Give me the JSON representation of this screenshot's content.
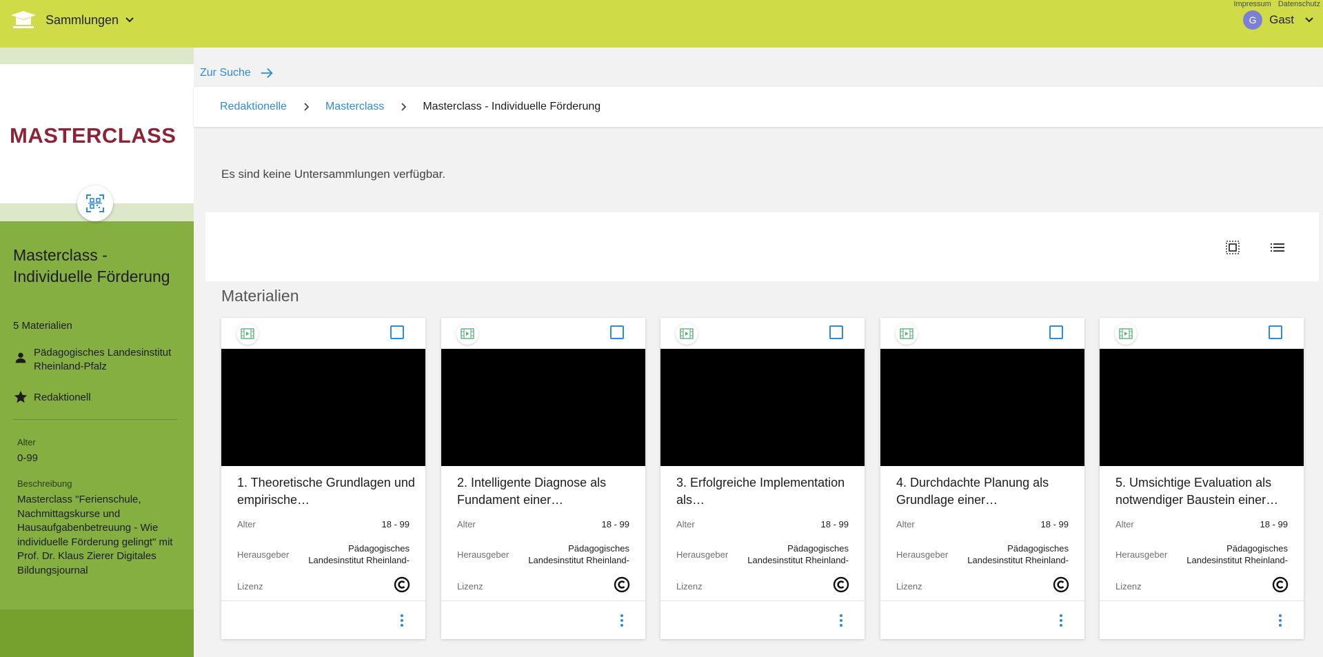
{
  "header": {
    "app_label": "Sammlungen",
    "impressum": "Impressum",
    "datenschutz": "Datenschutz",
    "user_initial": "G",
    "user_name": "Gast"
  },
  "sidebar": {
    "logo_text": "MASTERCLASS",
    "title": "Masterclass - Individuelle Förderung",
    "count": "5 Materialien",
    "publisher": "Pädagogisches Landesinstitut Rheinland-Pfalz",
    "editorial": "Redaktionell",
    "age_label": "Alter",
    "age_value": "0-99",
    "description_label": "Beschreibung",
    "description": "Masterclass \"Ferienschule, Nachmittagskurse und Hausaufgabenbetreuung - Wie individuelle Förderung gelingt\" mit Prof. Dr. Klaus Zierer Digitales Bildungsjournal"
  },
  "main": {
    "to_search": "Zur Suche",
    "breadcrumb": [
      "Redaktionelle",
      "Masterclass",
      "Masterclass - Individuelle Förderung"
    ],
    "no_subcollections": "Es sind keine Untersammlungen verfügbar.",
    "materials_heading": "Materialien"
  },
  "cards": [
    {
      "title": "1. Theoretische Grundlagen und empirische…",
      "age_label": "Alter",
      "age_value": "18 - 99",
      "publisher_label": "Herausgeber",
      "publisher_line1": "Pädagogisches",
      "publisher_line2": "Landesinstitut Rheinland-",
      "license_label": "Lizenz"
    },
    {
      "title": "2. Intelligente Diagnose als Fundament einer…",
      "age_label": "Alter",
      "age_value": "18 - 99",
      "publisher_label": "Herausgeber",
      "publisher_line1": "Pädagogisches",
      "publisher_line2": "Landesinstitut Rheinland-",
      "license_label": "Lizenz"
    },
    {
      "title": "3. Erfolgreiche Implementation als…",
      "age_label": "Alter",
      "age_value": "18 - 99",
      "publisher_label": "Herausgeber",
      "publisher_line1": "Pädagogisches",
      "publisher_line2": "Landesinstitut Rheinland-",
      "license_label": "Lizenz"
    },
    {
      "title": "4. Durchdachte Planung als Grundlage einer…",
      "age_label": "Alter",
      "age_value": "18 - 99",
      "publisher_label": "Herausgeber",
      "publisher_line1": "Pädagogisches",
      "publisher_line2": "Landesinstitut Rheinland-",
      "license_label": "Lizenz"
    },
    {
      "title": "5. Umsichtige Evaluation als notwendiger Baustein einer…",
      "age_label": "Alter",
      "age_value": "18 - 99",
      "publisher_label": "Herausgeber",
      "publisher_line1": "Pädagogisches",
      "publisher_line2": "Landesinstitut Rheinland-",
      "license_label": "Lizenz"
    }
  ],
  "colors": {
    "topbar": "#cfdb47",
    "sidebar": "#85b041",
    "link": "#2e8bd6",
    "logo": "#8b2436"
  },
  "icons": {
    "brand": "hat-icon",
    "qr": "qr-scan-icon",
    "publisher": "person-icon",
    "editorial": "star-icon",
    "grid_view": "grid-view-icon",
    "list_view": "list-view-icon",
    "card_type": "video-icon",
    "license": "copyright-icon",
    "card_menu": "more-vert-icon"
  }
}
